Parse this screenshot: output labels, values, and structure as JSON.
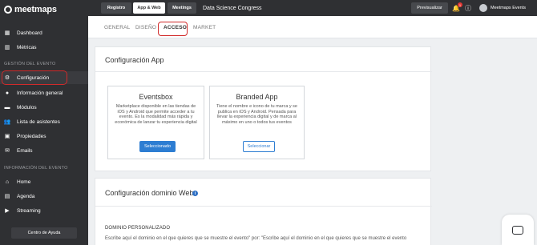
{
  "app": {
    "logo_text": "meetmaps"
  },
  "sidebar": {
    "items_top": [
      {
        "label": "Dashboard",
        "icon": "dashboard-icon"
      },
      {
        "label": "Métricas",
        "icon": "chart-icon"
      }
    ],
    "section_event": "GESTIÓN DEL EVENTO",
    "items_event": [
      {
        "label": "Configuración",
        "icon": "gear-icon"
      },
      {
        "label": "Información general",
        "icon": "info-icon"
      },
      {
        "label": "Módulos",
        "icon": "modules-icon"
      },
      {
        "label": "Lista de asistentes",
        "icon": "users-icon"
      },
      {
        "label": "Propiedades",
        "icon": "properties-icon"
      },
      {
        "label": "Emails",
        "icon": "email-icon"
      }
    ],
    "section_info": "INFORMACIÓN DEL EVENTO",
    "items_info": [
      {
        "label": "Home",
        "icon": "home-icon"
      },
      {
        "label": "Agenda",
        "icon": "calendar-icon"
      },
      {
        "label": "Streaming",
        "icon": "streaming-icon"
      }
    ],
    "help_label": "Centro de Ayuda"
  },
  "topbar": {
    "segments": [
      "Registro",
      "App & Web",
      "Meetings"
    ],
    "active_segment": "App & Web",
    "event_name": "Data Science Congress",
    "preview_label": "Previsualizar",
    "notification_count": "1",
    "user_name": "Meetmaps Events"
  },
  "tabs": [
    "GENERAL",
    "DISEÑO",
    "ACCESO",
    "MARKET"
  ],
  "active_tab": "ACCESO",
  "config_app": {
    "title": "Configuración App",
    "eventsbox": {
      "title": "Eventsbox",
      "description": "Marketplace disponible en las tiendas de iOS y Android que permite acceder a tu evento. Es la modalidad más rápida y económica de lanzar tu experiencia digital",
      "button": "Seleccionado"
    },
    "branded": {
      "title": "Branded App",
      "description": "Tiene el nombre e icono de tu marca y se publica en iOS y Android. Pensada para llevar la experiencia digital y de marca al máximo en uno o todos tus eventos",
      "button": "Seleccionar"
    }
  },
  "config_web": {
    "title": "Configuración dominio Web",
    "subhead": "DOMINIO PERSONALIZADO",
    "paragraph": "Escribe aquí el dominio en el que quieres que se muestre el evento\" por: \"Escribe aquí el dominio en el que quieres que se muestre el evento"
  },
  "colors": {
    "sidebar_bg": "#2f3033",
    "accent": "#2d7dd2",
    "highlight": "#d12a2a"
  }
}
